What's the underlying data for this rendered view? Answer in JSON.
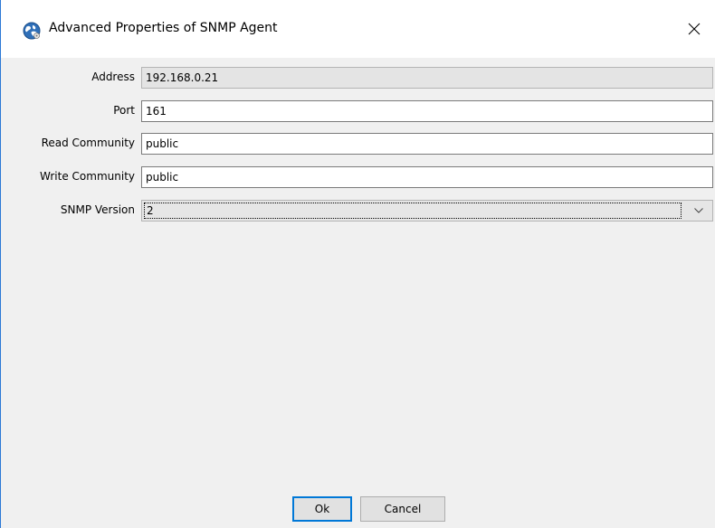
{
  "window": {
    "title": "Advanced Properties of SNMP Agent",
    "close_glyph": "✕"
  },
  "form": {
    "address": {
      "label": "Address",
      "value": "192.168.0.21"
    },
    "port": {
      "label": "Port",
      "value": "161"
    },
    "read_community": {
      "label": "Read Community",
      "value": "public"
    },
    "write_community": {
      "label": "Write Community",
      "value": "public"
    },
    "snmp_version": {
      "label": "SNMP Version",
      "value": "2"
    }
  },
  "buttons": {
    "ok_label": "Ok",
    "cancel_label": "Cancel"
  },
  "colors": {
    "accent": "#0078d7",
    "window_border": "#2b78d6",
    "dialog_bg": "#f0f0f0"
  },
  "icons": {
    "title": "globe-icon",
    "close": "close-icon",
    "dropdown": "chevron-down-icon"
  }
}
